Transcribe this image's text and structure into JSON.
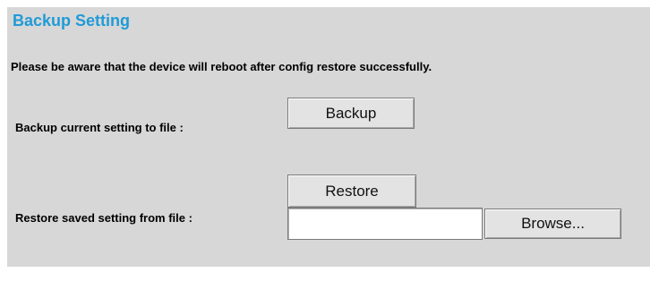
{
  "page": {
    "title": "Backup Setting",
    "notice": "Please be aware that the device will reboot after config restore successfully."
  },
  "backup": {
    "label": "Backup current setting to file :",
    "button_label": "Backup"
  },
  "restore": {
    "label": "Restore saved setting from file :",
    "button_label": "Restore",
    "file_value": "",
    "browse_label": "Browse..."
  },
  "colors": {
    "title": "#1f9bd7",
    "panel_background": "#d7d7d7",
    "button_background": "#e3e3e3"
  }
}
